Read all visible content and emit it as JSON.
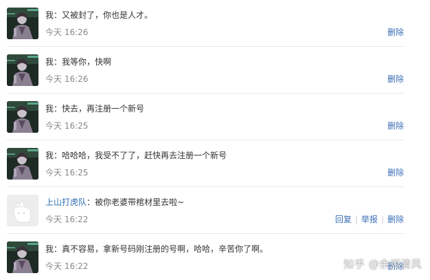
{
  "messages": [
    {
      "sender": "我",
      "separator": "：",
      "text": "又被封了，你也是人才。",
      "time": "今天 16:26",
      "avatar": "dark-character-avatar",
      "actions": [
        "删除"
      ]
    },
    {
      "sender": "我",
      "separator": "：",
      "text": "我等你，快啊",
      "time": "今天 16:26",
      "avatar": "dark-character-avatar",
      "actions": [
        "删除"
      ]
    },
    {
      "sender": "我",
      "separator": "：",
      "text": "快去，再注册一个新号",
      "time": "今天 16:25",
      "avatar": "dark-character-avatar",
      "actions": [
        "删除"
      ]
    },
    {
      "sender": "我",
      "separator": "：",
      "text": "哈哈哈，我受不了了，赶快再去注册一个新号",
      "time": "今天 16:25",
      "avatar": "dark-character-avatar",
      "actions": [
        "删除"
      ]
    },
    {
      "sender": "上山打虎队",
      "separator": "：",
      "text": "被你老婆带棺材里去啦~",
      "time": "今天 16:22",
      "avatar": "default-gray-avatar",
      "actions": [
        "回复",
        "举报",
        "删除"
      ]
    },
    {
      "sender": "我",
      "separator": "：",
      "text": "真不容易，拿新号码刚注册的号啊，哈哈，辛苦你了啊。",
      "time": "今天 16:22",
      "avatar": "dark-character-avatar",
      "actions": [
        "删除"
      ]
    }
  ],
  "watermark": "知乎 @余烬清风",
  "colors": {
    "link": "#3b6fb6",
    "text": "#333333",
    "time": "#888888",
    "divider": "#e8e8e8"
  }
}
